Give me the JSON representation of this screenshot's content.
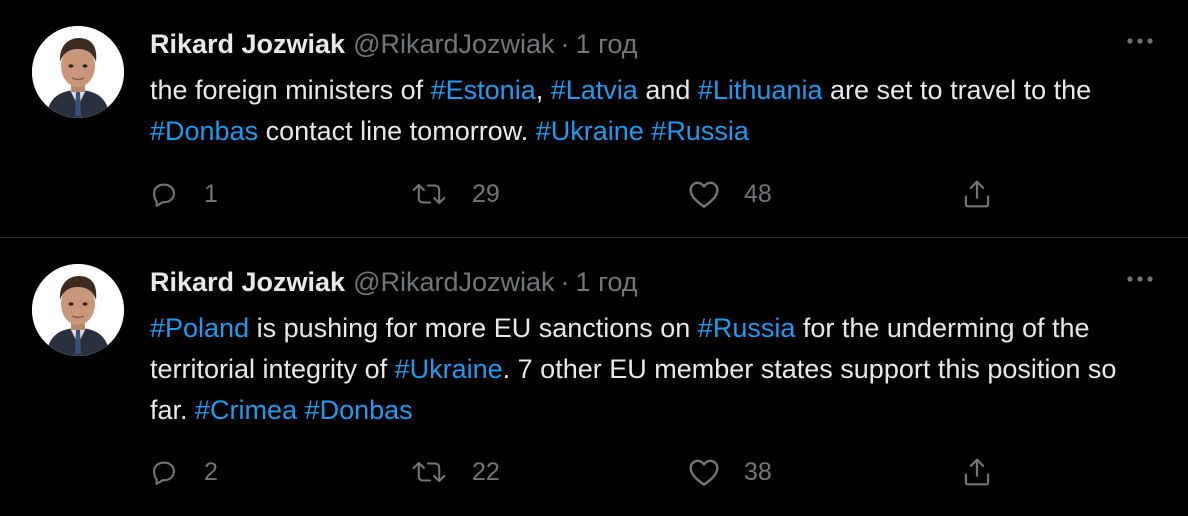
{
  "tweets": [
    {
      "author_name": "Rikard Jozwiak",
      "handle": "@RikardJozwiak",
      "separator": "·",
      "time": "1 год",
      "text_segments": [
        {
          "text": "the foreign ministers of ",
          "tag": false
        },
        {
          "text": "#Estonia",
          "tag": true
        },
        {
          "text": ", ",
          "tag": false
        },
        {
          "text": "#Latvia",
          "tag": true
        },
        {
          "text": " and ",
          "tag": false
        },
        {
          "text": "#Lithuania",
          "tag": true
        },
        {
          "text": " are set to travel to the ",
          "tag": false
        },
        {
          "text": "#Donbas",
          "tag": true
        },
        {
          "text": " contact line tomorrow. ",
          "tag": false
        },
        {
          "text": "#Ukraine",
          "tag": true
        },
        {
          "text": " ",
          "tag": false
        },
        {
          "text": "#Russia",
          "tag": true
        }
      ],
      "replies": "1",
      "retweets": "29",
      "likes": "48"
    },
    {
      "author_name": "Rikard Jozwiak",
      "handle": "@RikardJozwiak",
      "separator": "·",
      "time": "1 год",
      "text_segments": [
        {
          "text": "#Poland",
          "tag": true
        },
        {
          "text": " is pushing for more EU sanctions on ",
          "tag": false
        },
        {
          "text": "#Russia",
          "tag": true
        },
        {
          "text": " for the underming of the territorial integrity of ",
          "tag": false
        },
        {
          "text": "#Ukraine",
          "tag": true
        },
        {
          "text": ". 7 other EU member states support this position so far. ",
          "tag": false
        },
        {
          "text": "#Crimea",
          "tag": true
        },
        {
          "text": " ",
          "tag": false
        },
        {
          "text": "#Donbas",
          "tag": true
        }
      ],
      "replies": "2",
      "retweets": "22",
      "likes": "38"
    }
  ],
  "icons": {
    "reply": "reply-icon",
    "retweet": "retweet-icon",
    "like": "heart-icon",
    "share": "share-icon",
    "more": "more-icon"
  },
  "colors": {
    "background": "#000000",
    "text": "#e7e9ea",
    "secondary": "#71767b",
    "hashtag": "#1d9bf0",
    "divider": "#2f3336"
  }
}
